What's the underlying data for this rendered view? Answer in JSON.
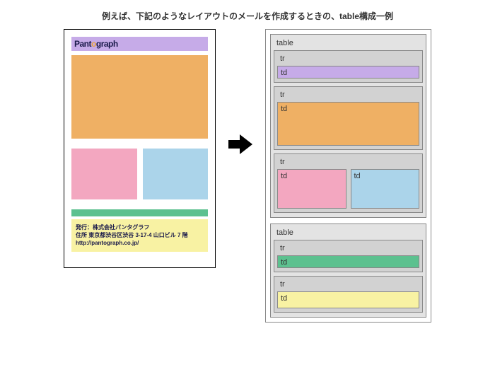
{
  "title": "例えば、下記のようなレイアウトのメールを作成するときの、table構成一例",
  "logo": {
    "pre": "Pant",
    "o": "o",
    "post": "graph"
  },
  "footer": {
    "line1": "発行：株式会社パンタグラフ",
    "line2": "住所 東京都渋谷区渋谷 3-17-4 山口ビル 7 階",
    "line3": "http://pantograph.co.jp/"
  },
  "labels": {
    "table": "table",
    "tr": "tr",
    "td": "td"
  }
}
